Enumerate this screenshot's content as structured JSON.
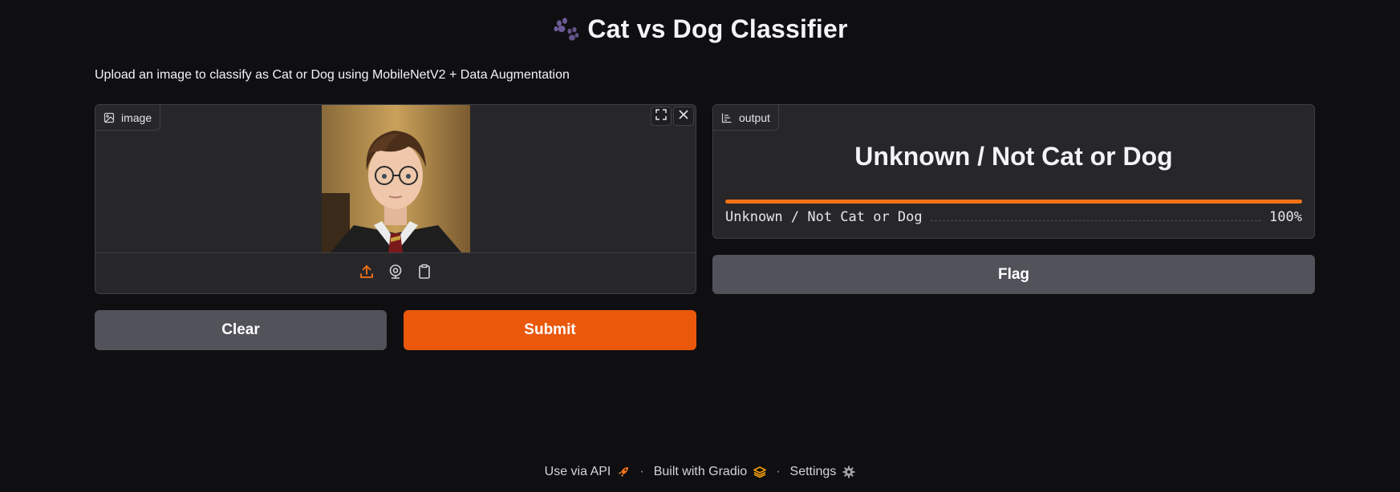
{
  "header": {
    "icon": "paw-prints-icon",
    "title": "Cat vs Dog Classifier",
    "description": "Upload an image to classify as Cat or Dog using MobileNetV2 + Data Augmentation"
  },
  "input": {
    "label": "image",
    "label_icon": "image-icon",
    "controls": [
      "fullscreen-icon",
      "close-icon"
    ],
    "sources": [
      "upload-icon",
      "webcam-icon",
      "clipboard-icon"
    ],
    "image_alt": "portrait photo"
  },
  "actions": {
    "clear_label": "Clear",
    "submit_label": "Submit"
  },
  "output": {
    "label": "output",
    "label_icon": "bar-chart-icon",
    "prediction": "Unknown / Not Cat or Dog",
    "confidences": [
      {
        "label": "Unknown / Not Cat or Dog",
        "value": "100%",
        "fraction": 1.0
      }
    ],
    "flag_label": "Flag"
  },
  "footer": {
    "api_label": "Use via API",
    "built_label": "Built with Gradio",
    "settings_label": "Settings",
    "separator": "·"
  },
  "colors": {
    "accent": "#ea580c",
    "background": "#0f0f11",
    "panel": "#27272a",
    "secondary_button": "#52525b"
  }
}
